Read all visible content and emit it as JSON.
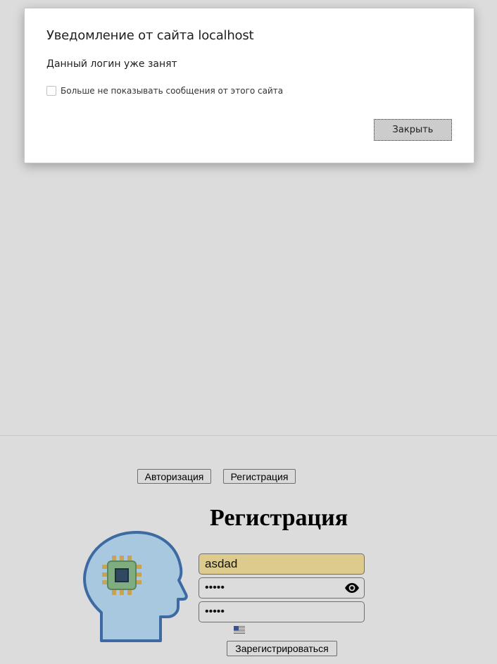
{
  "dialog": {
    "title": "Уведомление от сайта localhost",
    "message": "Данный логин уже занят",
    "checkbox_label": "Больше не показывать сообщения от этого сайта",
    "checkbox_checked": false,
    "close_label": "Закрыть"
  },
  "nav": {
    "auth_label": "Авторизация",
    "register_label": "Регистрация"
  },
  "form": {
    "heading": "Регистрация",
    "login_value": "asdad",
    "password_value": "•••••",
    "password_confirm_value": "•••••",
    "submit_label": "Зарегистрироваться",
    "language_flag": "us-flag-icon"
  },
  "colors": {
    "page_bg": "#dcdcdc",
    "autofill_bg": "#dccb8c"
  }
}
